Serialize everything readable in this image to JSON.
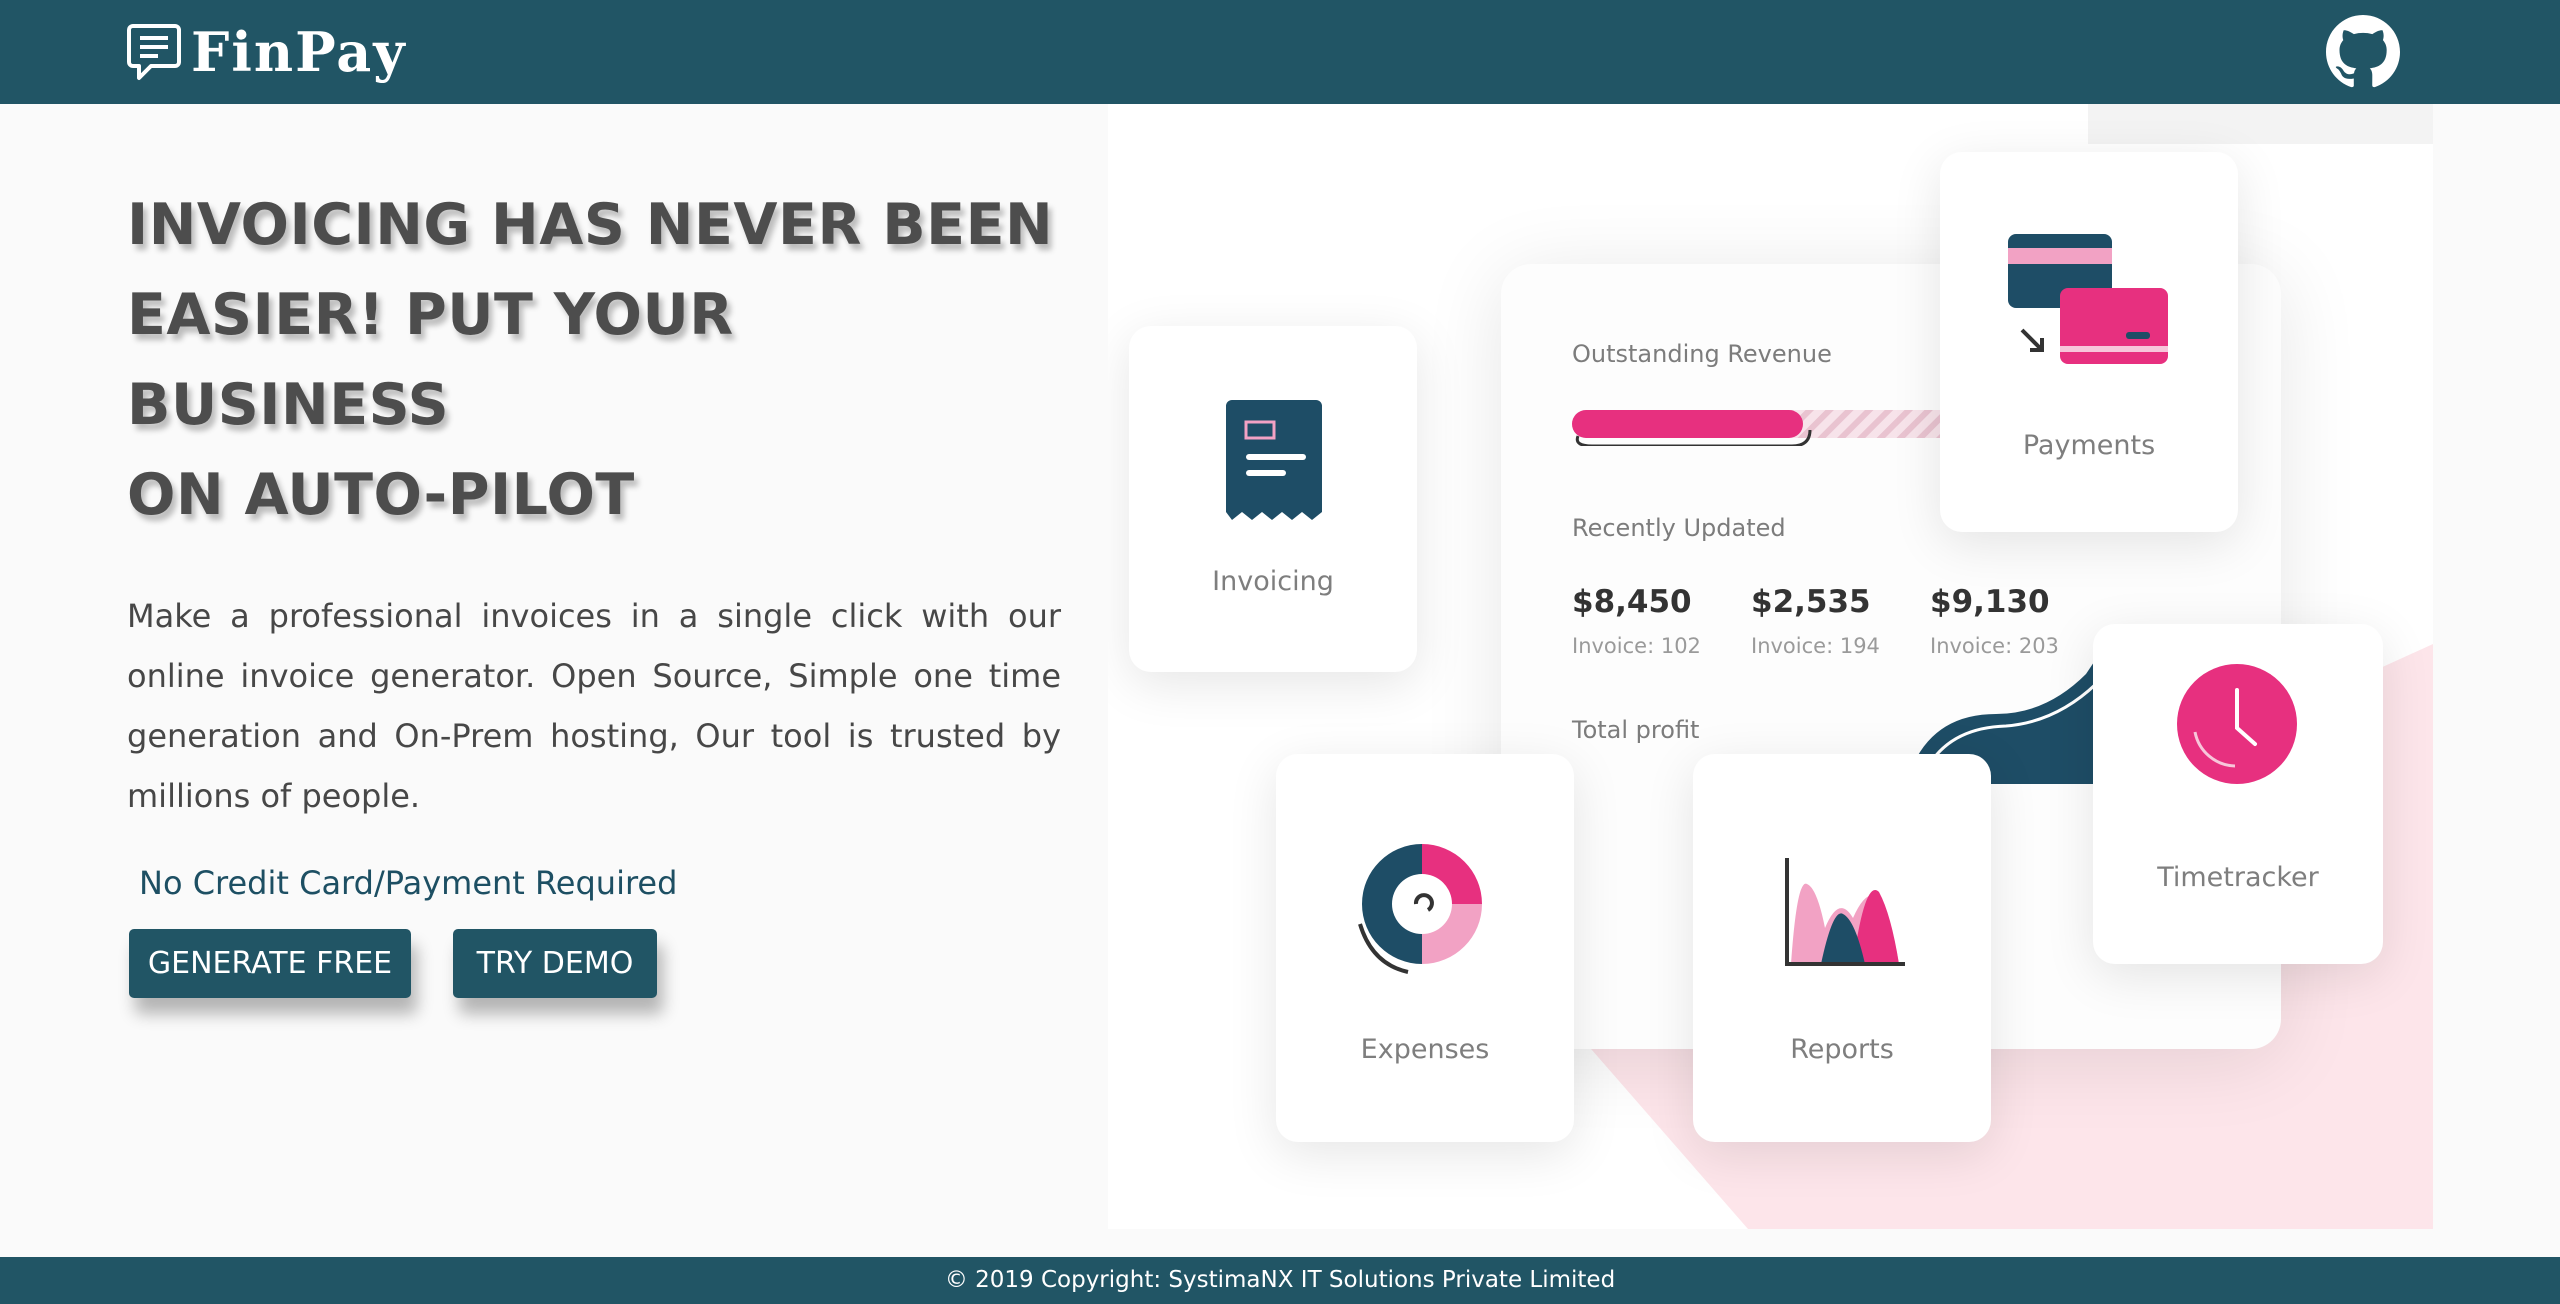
{
  "header": {
    "brand_name": "FinPay",
    "brand_icon": "invoice-chat-icon",
    "github_icon": "github-icon"
  },
  "hero": {
    "headline_line1": "INVOICING HAS NEVER BEEN",
    "headline_line2": "EASIER! PUT YOUR BUSINESS",
    "headline_line3": "ON AUTO-PILOT",
    "description": "Make a professional invoices in a single click with our online invoice generator. Open Source, Simple one time generation and On-Prem hosting, Our tool is trusted by millions of people.",
    "note": "No Credit Card/Payment Required",
    "generate_button": "GENERATE FREE",
    "demo_button": "TRY DEMO"
  },
  "illustration": {
    "outstanding_revenue_label": "Outstanding Revenue",
    "outstanding_revenue_progress": 0.55,
    "recently_updated_label": "Recently Updated",
    "recent": [
      {
        "amount": "$8,450",
        "invoice": "Invoice: 102"
      },
      {
        "amount": "$2,535",
        "invoice": "Invoice: 194"
      },
      {
        "amount": "$9,130",
        "invoice": "Invoice: 203"
      }
    ],
    "total_profit_label": "Total profit",
    "cards": {
      "invoicing": "Invoicing",
      "payments": "Payments",
      "expenses": "Expenses",
      "reports": "Reports",
      "timetracker": "Timetracker"
    }
  },
  "footer": {
    "copyright": "© 2019 Copyright: SystimaNX IT Solutions Private Limited"
  },
  "colors": {
    "primary": "#215565",
    "accent_pink": "#e7307f",
    "light_pink": "#f2a2c4",
    "navy": "#1e4d66"
  }
}
